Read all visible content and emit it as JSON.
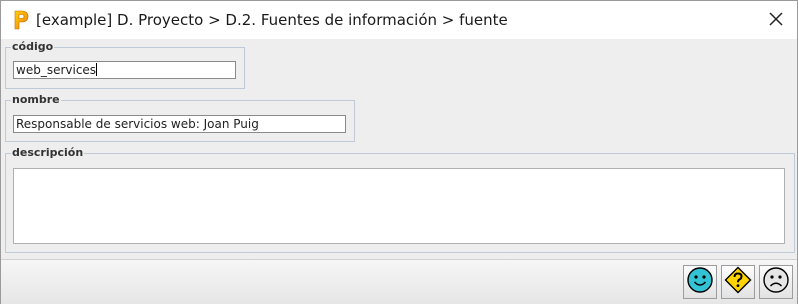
{
  "window": {
    "title": "[example] D. Proyecto > D.2. Fuentes de información > fuente",
    "app_icon": "p-logo-icon",
    "close_icon": "close-icon"
  },
  "form": {
    "codigo": {
      "label": "código",
      "value": "web_services"
    },
    "nombre": {
      "label": "nombre",
      "value": "Responsable de servicios web: Joan Puig"
    },
    "descripcion": {
      "label": "descripción",
      "value": ""
    }
  },
  "actions": [
    {
      "name": "ok",
      "icon": "smiley-happy-icon",
      "color": "#33c3d4"
    },
    {
      "name": "help",
      "icon": "question-diamond-icon",
      "color": "#ffd400"
    },
    {
      "name": "cancel",
      "icon": "smiley-sad-icon",
      "color": "#e6e6e6"
    }
  ],
  "colors": {
    "accent_border": "#bfcad6",
    "logo_orange": "#f29c1f",
    "logo_yellow": "#ffd200"
  }
}
